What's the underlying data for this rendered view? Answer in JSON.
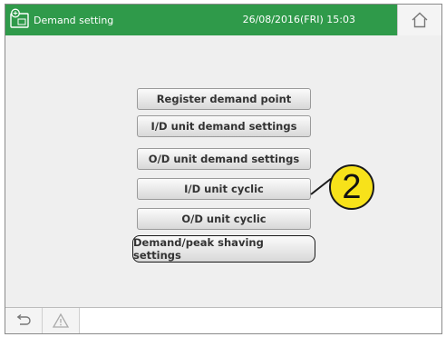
{
  "header": {
    "title": "Demand setting",
    "datetime": "26/08/2016(FRI) 15:03",
    "app_icon": "monitor-phone-icon",
    "home_icon": "home-icon",
    "color": "#2f9a4a"
  },
  "menu": {
    "buttons": [
      {
        "label": "Register demand point"
      },
      {
        "label": "I/D unit demand settings"
      },
      {
        "label": "O/D unit demand settings"
      },
      {
        "label": "I/D unit cyclic"
      },
      {
        "label": "O/D unit cyclic"
      },
      {
        "label": "Demand/peak shaving settings"
      }
    ]
  },
  "callout": {
    "number": "2",
    "color": "#f7e21a"
  },
  "footer": {
    "back_icon": "back-icon",
    "warning_icon": "warning-icon"
  }
}
